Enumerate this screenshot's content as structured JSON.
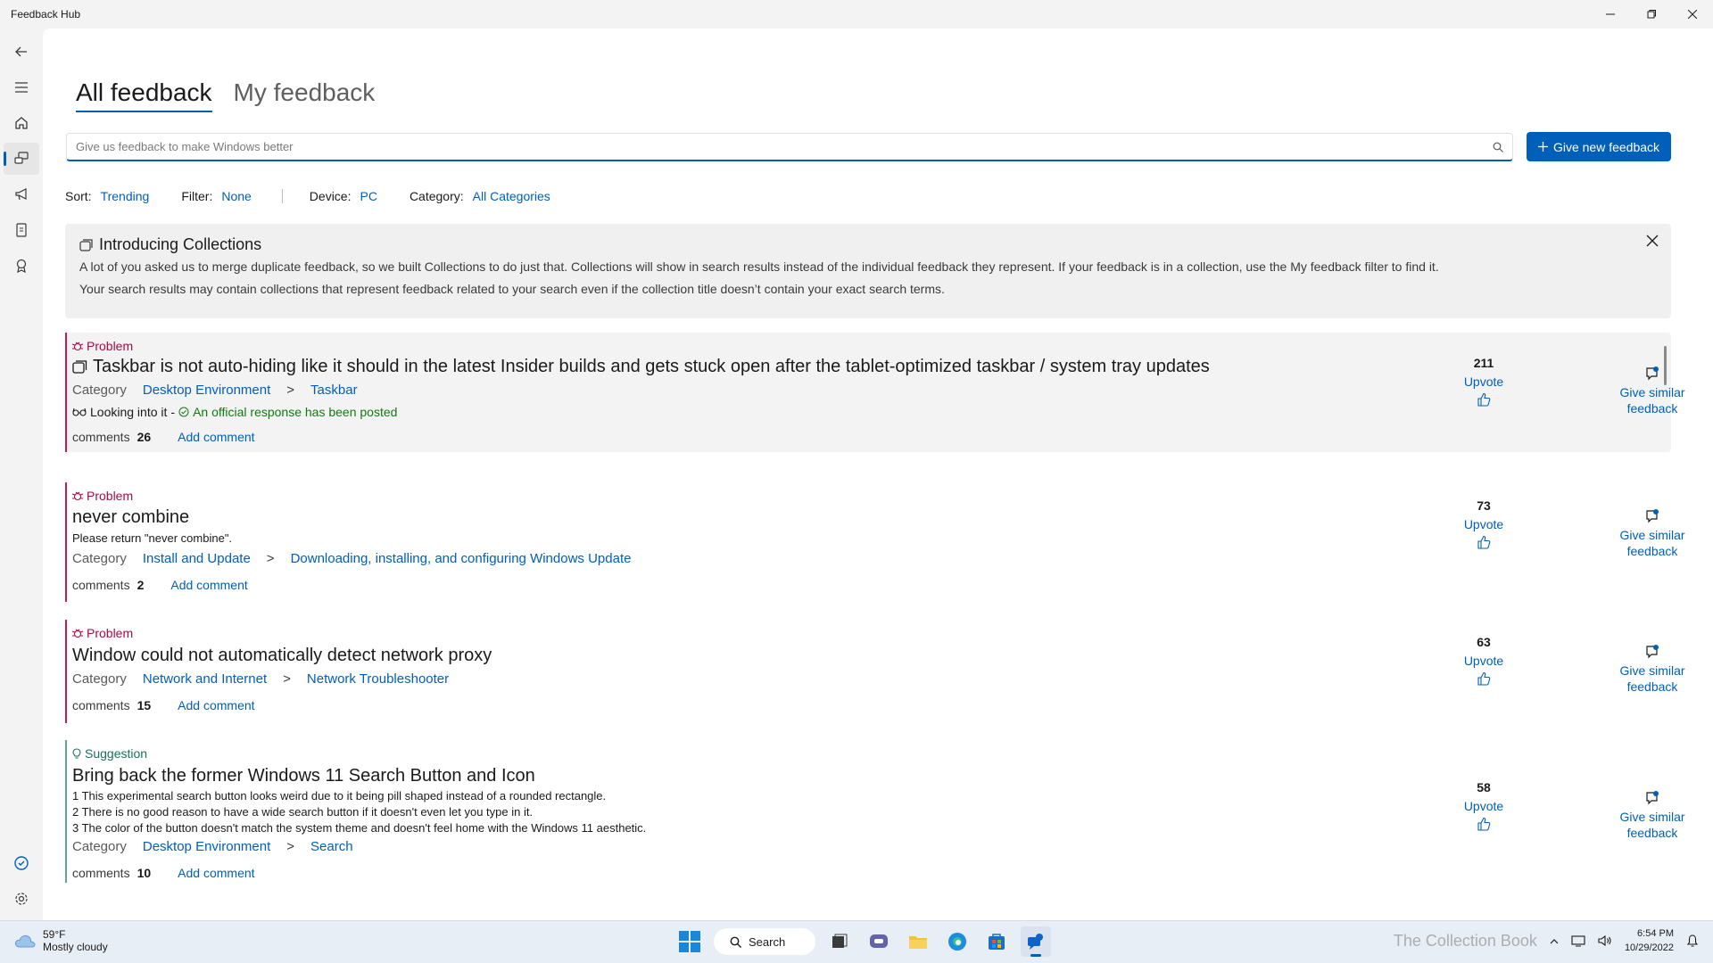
{
  "window": {
    "title": "Feedback Hub"
  },
  "tabs": [
    {
      "label": "All feedback",
      "active": true
    },
    {
      "label": "My feedback",
      "active": false
    }
  ],
  "search": {
    "placeholder": "Give us feedback to make Windows better"
  },
  "new_feedback_button": "Give new feedback",
  "filters": {
    "sort_label": "Sort:",
    "sort_value": "Trending",
    "filter_label": "Filter:",
    "filter_value": "None",
    "device_label": "Device:",
    "device_value": "PC",
    "category_label": "Category:",
    "category_value": "All Categories"
  },
  "banner": {
    "title": "Introducing Collections",
    "line1": "A lot of you asked us to merge duplicate feedback, so we built Collections to do just that. Collections will show in search results instead of the individual feedback they represent. If your feedback is in a collection, use the My feedback filter to find it.",
    "line2": "Your search results may contain collections that represent feedback related to your search even if the collection title doesn’t contain your exact search terms."
  },
  "labels": {
    "category": "Category",
    "comments": "comments",
    "add_comment": "Add comment",
    "upvote": "Upvote",
    "give_similar_1": "Give similar",
    "give_similar_2": "feedback",
    "arrow": ">"
  },
  "items": [
    {
      "type": "Problem",
      "title": "Taskbar is not auto-hiding like it should in the latest Insider builds and gets stuck open after the tablet-optimized taskbar / system tray updates",
      "category": "Desktop Environment",
      "subcategory": "Taskbar",
      "status": "Looking into it",
      "status_sep": "-",
      "official": "An official response has been posted",
      "comments": "26",
      "votes": "211"
    },
    {
      "type": "Problem",
      "title": "never combine",
      "description": "Please return \"never combine\".",
      "category": "Install and Update",
      "subcategory": "Downloading, installing, and configuring Windows Update",
      "comments": "2",
      "votes": "73"
    },
    {
      "type": "Problem",
      "title": "Window could not automatically detect network proxy",
      "category": "Network and Internet",
      "subcategory": "Network Troubleshooter",
      "comments": "15",
      "votes": "63"
    },
    {
      "type": "Suggestion",
      "title": "Bring back the former Windows 11 Search Button and Icon",
      "description_lines": [
        "1 This experimental search button looks weird due to it being pill shaped instead of a rounded rectangle.",
        "2 There is no good reason to have a wide search button if it doesn't even let you type in it.",
        "3 The color of the button doesn't match the system theme and doesn't feel home with the Windows 11 aesthetic."
      ],
      "category": "Desktop Environment",
      "subcategory": "Search",
      "comments": "10",
      "votes": "58"
    }
  ],
  "taskbar": {
    "temperature": "59°F",
    "weather": "Mostly cloudy",
    "search_label": "Search",
    "time": "6:54 PM",
    "date": "10/29/2022",
    "watermark": "The Collection Book"
  },
  "colors": {
    "accent": "#005fb8",
    "problem": "#a10e4a",
    "suggestion": "#1b6f5c",
    "official": "#0f7b0f"
  }
}
